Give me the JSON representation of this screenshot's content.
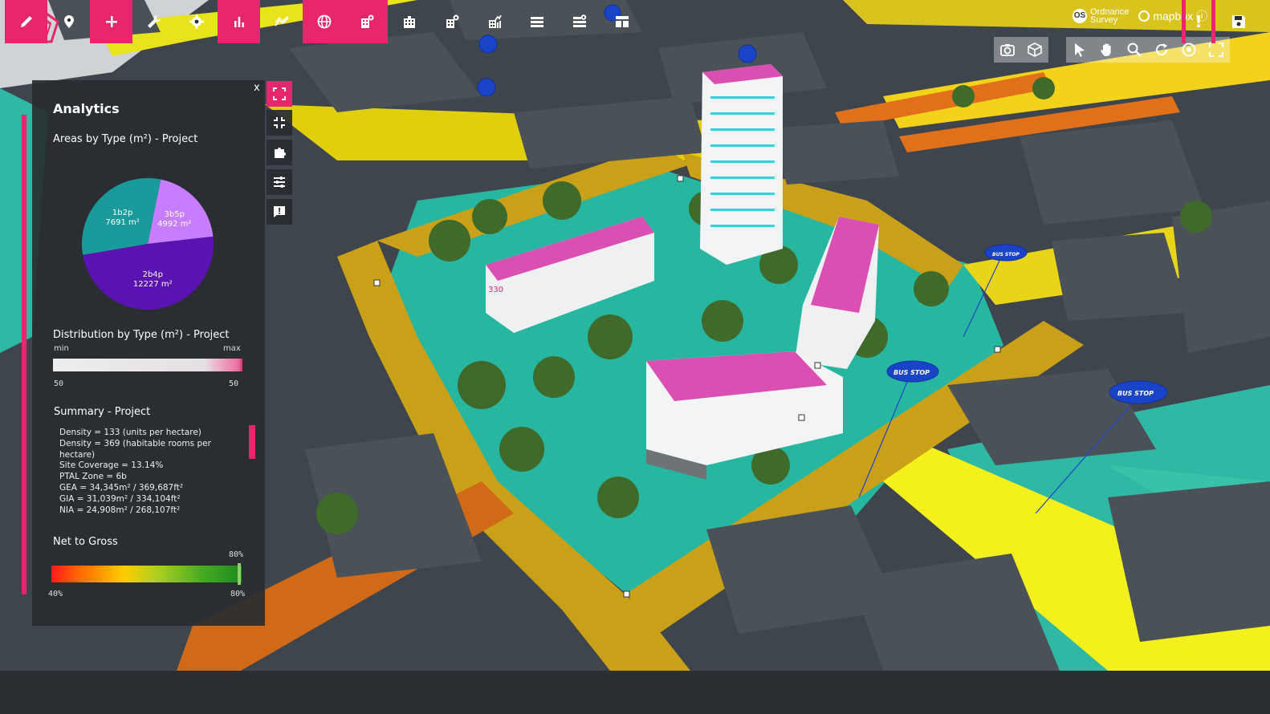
{
  "app": {
    "brand_color": "#e8266d"
  },
  "attribution": {
    "os_line1": "Ordnance",
    "os_line2": "Survey",
    "mapbox": "mapbox",
    "info": "ⓘ"
  },
  "top_toolbar": {
    "left_group": [
      "camera-icon",
      "cube-icon"
    ],
    "right_group": [
      "pointer-icon",
      "hand-icon",
      "zoom-icon",
      "rotate-icon",
      "target-icon",
      "fullscreen-icon"
    ]
  },
  "map": {
    "bus_stop_label": "BUS STOP",
    "building_tag": "330"
  },
  "panel": {
    "close": "x",
    "title": "Analytics",
    "areas": {
      "title": "Areas by Type (m²) - Project",
      "slices": [
        {
          "label": "3b5p",
          "value_text": "4992 m²",
          "value": 4992,
          "color": "#c77dff"
        },
        {
          "label": "2b4p",
          "value_text": "12227 m²",
          "value": 12227,
          "color": "#5a12b0"
        },
        {
          "label": "1b2p",
          "value_text": "7691 m²",
          "value": 7691,
          "color": "#1a9a9a"
        }
      ]
    },
    "distribution": {
      "title": "Distribution by Type (m²) - Project",
      "min_label": "min",
      "max_label": "max",
      "low": "50",
      "high": "50"
    },
    "summary": {
      "title": "Summary - Project",
      "lines": [
        "Density = 133 (units per hectare)",
        "Density = 369 (habitable rooms per hectare)",
        "Site Coverage = 13.14%",
        "PTAL Zone = 6b",
        "GEA = 34,345m² / 369,687ft²",
        "GIA = 31,039m² / 334,104ft²",
        "NIA = 24,908m² / 268,107ft²"
      ]
    },
    "net_to_gross": {
      "title": "Net to Gross",
      "value_label": "80%",
      "low": "40%",
      "high": "80%",
      "value": 0.8
    }
  },
  "side_buttons": [
    "expand-icon",
    "collapse-icon",
    "puzzle-icon",
    "sliders-icon",
    "comment-icon"
  ],
  "bottom_bar": {
    "buttons": [
      {
        "name": "edit-button",
        "icon": "pencil-icon",
        "pink": true
      },
      {
        "name": "location-button",
        "icon": "pin-icon",
        "pink": false
      },
      {
        "name": "add-button",
        "icon": "plus-icon",
        "pink": true
      },
      {
        "name": "tools-button",
        "icon": "wrench-icon",
        "pink": false
      },
      {
        "name": "settings-button",
        "icon": "gear-icon",
        "pink": false
      },
      {
        "name": "analytics-button",
        "icon": "bar-chart-icon",
        "pink": true
      },
      {
        "name": "trend-button",
        "icon": "trend-icon",
        "pink": false
      },
      {
        "name": "globe-button",
        "icon": "globe-icon",
        "pink": true
      },
      {
        "name": "building-view-button",
        "icon": "building-eye-icon",
        "pink": true
      },
      {
        "name": "building-button",
        "icon": "building-icon",
        "pink": false
      },
      {
        "name": "building-settings-button",
        "icon": "building-gear-icon",
        "pink": false
      },
      {
        "name": "building-chart-button",
        "icon": "building-chart-icon",
        "pink": false
      },
      {
        "name": "layers-button",
        "icon": "layers-icon",
        "pink": false
      },
      {
        "name": "layer-view-button",
        "icon": "layer-eye-icon",
        "pink": false
      },
      {
        "name": "grid-button",
        "icon": "grid-icon",
        "pink": false
      }
    ],
    "alert": "!",
    "save_icon": "save-icon"
  }
}
